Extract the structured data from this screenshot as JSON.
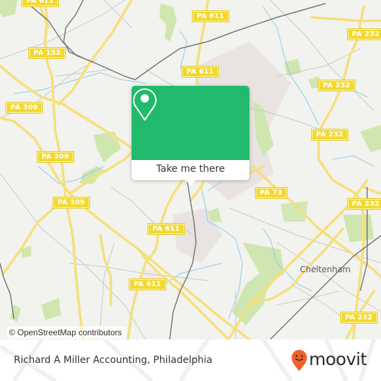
{
  "map": {
    "attribution": "© OpenStreetMap contributors",
    "colors": {
      "background": "#f2f2ee",
      "road_major": "#f5e07a",
      "road_minor": "#c8c8c4",
      "rail": "#777777",
      "water": "#8ecbe8",
      "park": "#cfe6b0",
      "urban": "#e8e2e0",
      "shield_fill": "#f2d92e"
    },
    "route_shields": [
      {
        "label": "PA 152"
      },
      {
        "label": "PA 309"
      },
      {
        "label": "PA 309"
      },
      {
        "label": "PA 309"
      },
      {
        "label": "PA 611"
      },
      {
        "label": "PA 611"
      },
      {
        "label": "PA 611"
      },
      {
        "label": "PA 611"
      },
      {
        "label": "PA 611"
      },
      {
        "label": "PA 232"
      },
      {
        "label": "PA 232"
      },
      {
        "label": "PA 232"
      },
      {
        "label": "PA 232"
      },
      {
        "label": "PA 232"
      },
      {
        "label": "PA 73"
      }
    ],
    "place_labels": [
      {
        "label": "Cheltenham"
      }
    ]
  },
  "popup": {
    "icon": "map-pin-icon",
    "button_label": "Take me there",
    "accent_color": "#21b96b"
  },
  "footer": {
    "title": "Richard A Miller Accounting, Philadelphia",
    "logo_text": "moovit",
    "logo_color": "#f0622a"
  }
}
